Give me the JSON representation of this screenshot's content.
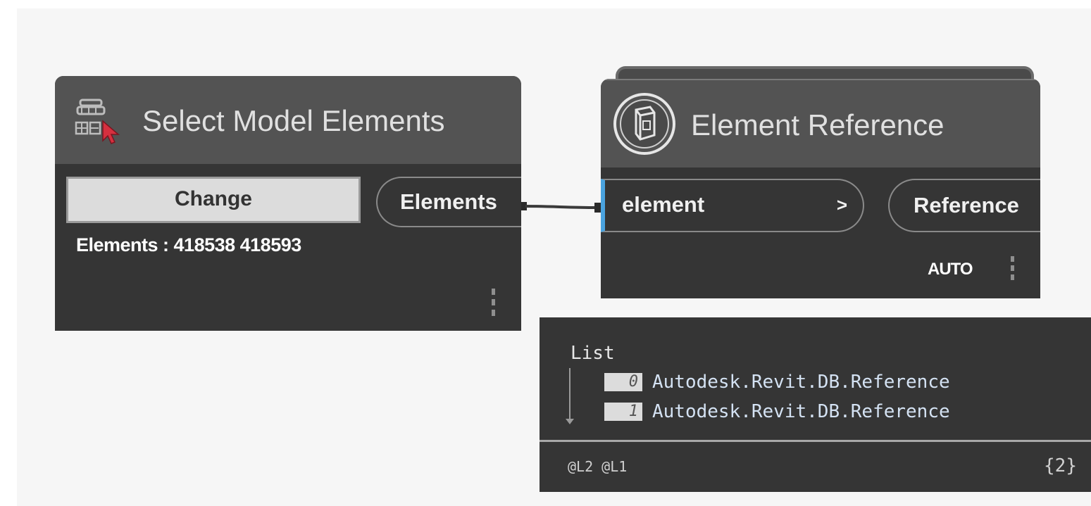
{
  "select_node": {
    "title": "Select Model Elements",
    "change_button": "Change",
    "output_port": "Elements",
    "selection_text": "Elements : 418538 418593"
  },
  "reference_node": {
    "title": "Element Reference",
    "input_port": "element",
    "input_chevron": ">",
    "output_port": "Reference",
    "lacing": "AUTO"
  },
  "preview": {
    "list_label": "List",
    "items": [
      {
        "index": "0",
        "value": "Autodesk.Revit.DB.Reference"
      },
      {
        "index": "1",
        "value": "Autodesk.Revit.DB.Reference"
      }
    ],
    "levels": "@L2 @L1",
    "count": "{2}"
  },
  "colors": {
    "canvas": "#f6f6f6",
    "node_body": "#353535",
    "node_header": "#535353",
    "input_port_accent": "#4aa3df"
  }
}
